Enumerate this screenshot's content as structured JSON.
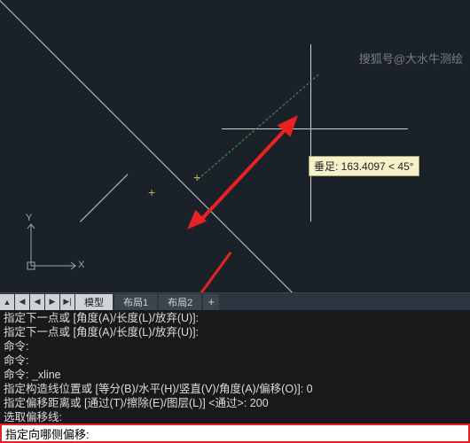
{
  "watermark": "搜狐号@大水牛测绘",
  "tooltip": "垂足: 163.4097 < 45°",
  "ucs": {
    "x_label": "X",
    "y_label": "Y"
  },
  "tabs": {
    "nav": {
      "b1": "▲",
      "b2": "◀",
      "b3": "▶",
      "b4": "▶|"
    },
    "model": "模型",
    "layout1": "布局1",
    "layout2": "布局2",
    "plus": "+"
  },
  "history": [
    "指定下一点或 [角度(A)/长度(L)/放弃(U)]:",
    "指定下一点或 [角度(A)/长度(L)/放弃(U)]:",
    "命令:",
    "命令:",
    "命令: _xline",
    "指定构造线位置或  [等分(B)/水平(H)/竖直(V)/角度(A)/偏移(O)]:  0",
    "指定偏移距离或  [通过(T)/擦除(E)/图层(L)] <通过>:  200",
    "选取偏移线:"
  ],
  "prompt": "指定向哪侧偏移:"
}
